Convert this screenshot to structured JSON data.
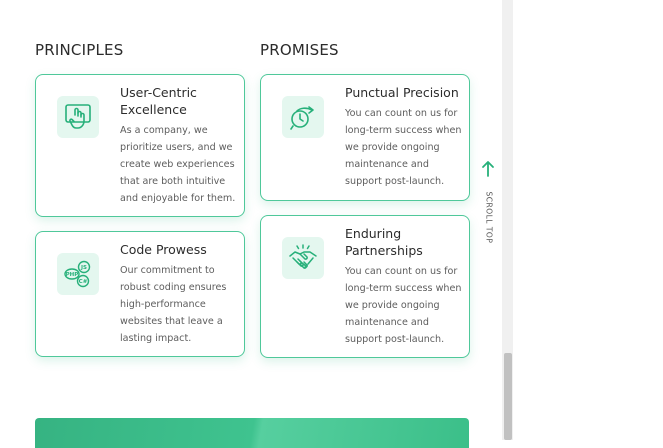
{
  "principles": {
    "heading": "PRINCIPLES",
    "cards": [
      {
        "title": "User-Centric Excellence",
        "text": "As a company, we prioritize users, and we create web experiences that are both intuitive and enjoyable for them.",
        "icon": "touch-screen-icon"
      },
      {
        "title": "Code Prowess",
        "text": "Our commitment to robust coding ensures high-performance websites that leave a lasting impact.",
        "icon": "code-languages-icon",
        "icon_labels": [
          "JS",
          "PHP",
          "C#"
        ]
      }
    ]
  },
  "promises": {
    "heading": "PROMISES",
    "cards": [
      {
        "title": "Punctual Precision",
        "text": "You can count on us for long-term success when we provide ongoing maintenance and support post-launch.",
        "icon": "clock-arrow-icon"
      },
      {
        "title": "Enduring Partnerships",
        "text": "You can count on us for long-term success when we provide ongoing maintenance and support post-launch.",
        "icon": "handshake-icon"
      }
    ]
  },
  "scroll_top": {
    "label": "SCROLL TOP",
    "icon": "arrow-up-icon"
  },
  "colors": {
    "accent": "#27b07a",
    "card_border": "#4fc89a",
    "icon_bg": "#e4f7ef"
  }
}
